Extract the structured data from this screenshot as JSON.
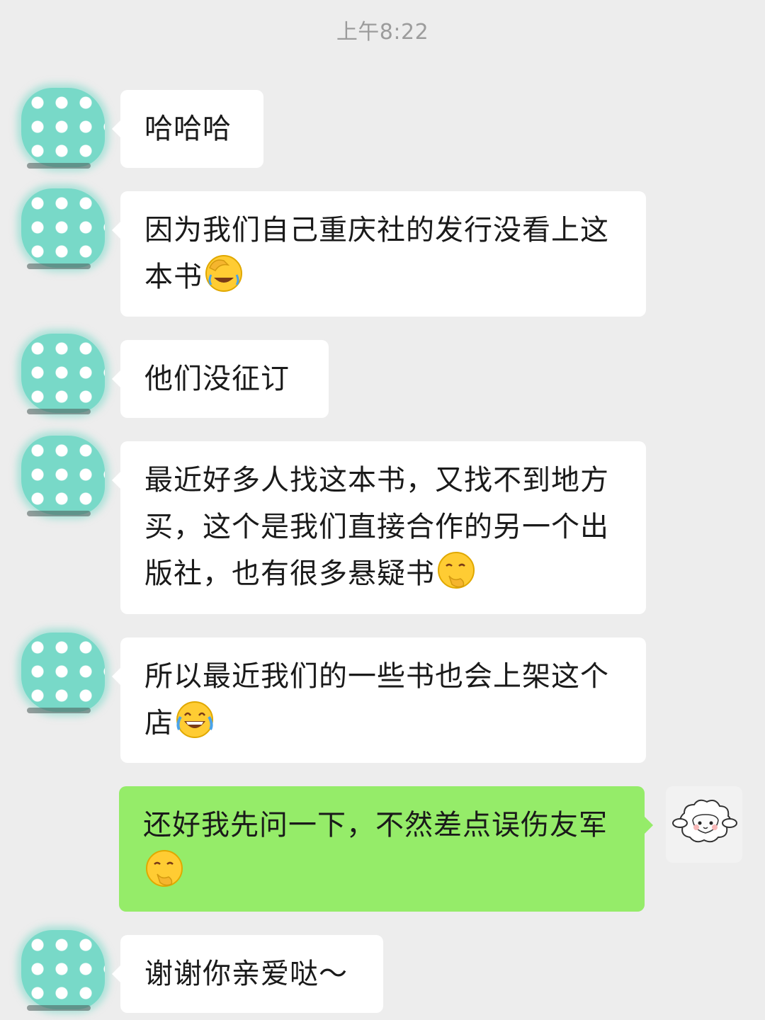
{
  "timestamp": "上午8:22",
  "messages": [
    {
      "sender": "other",
      "text": "哈哈哈",
      "emoji": ""
    },
    {
      "sender": "other",
      "text": "因为我们自己重庆社的发行没看上这本书",
      "emoji": "facepalm-laugh-emoji"
    },
    {
      "sender": "other",
      "text": "他们没征订",
      "emoji": ""
    },
    {
      "sender": "other",
      "text": "最近好多人找这本书，又找不到地方买，这个是我们直接合作的另一个出版社，也有很多悬疑书",
      "emoji": "smirk-hand-emoji"
    },
    {
      "sender": "other",
      "text": "所以最近我们的一些书也会上架这个店",
      "emoji": "tears-of-joy-emoji"
    },
    {
      "sender": "self",
      "text": "还好我先问一下，不然差点误伤友军",
      "emoji": "smirk-hand-emoji"
    },
    {
      "sender": "other",
      "text": "谢谢你亲爱哒～",
      "emoji": ""
    }
  ],
  "colors": {
    "background": "#ededed",
    "incoming_bubble": "#ffffff",
    "outgoing_bubble": "#95ec69",
    "avatar": "#78d9c8"
  }
}
